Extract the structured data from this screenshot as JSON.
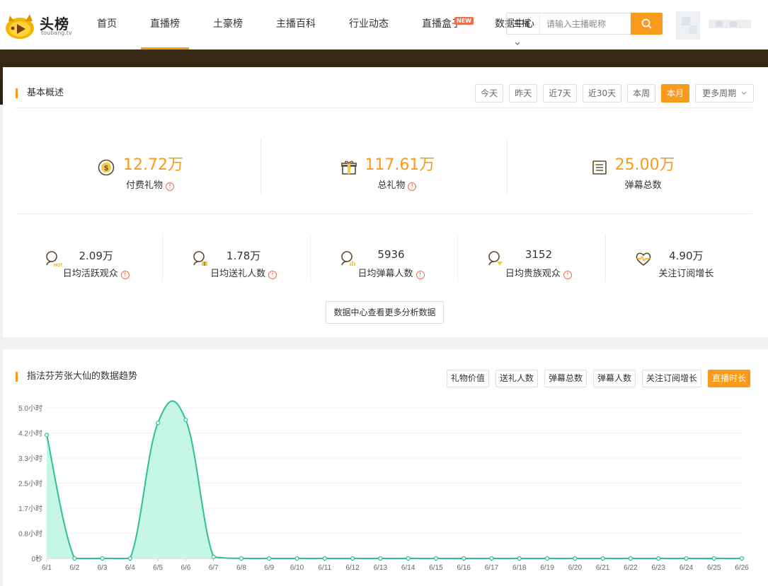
{
  "header": {
    "logo_text": "头榜",
    "logo_sub": "toubang.tv",
    "nav": [
      {
        "label": "首页",
        "active": false,
        "badge": ""
      },
      {
        "label": "直播榜",
        "active": true,
        "badge": ""
      },
      {
        "label": "土豪榜",
        "active": false,
        "badge": ""
      },
      {
        "label": "主播百科",
        "active": false,
        "badge": ""
      },
      {
        "label": "行业动态",
        "active": false,
        "badge": ""
      },
      {
        "label": "直播盒子",
        "active": false,
        "badge": "NEW"
      },
      {
        "label": "数据中心",
        "active": false,
        "badge": ""
      }
    ],
    "search": {
      "type_label": "主播",
      "placeholder": "请输入主播昵称"
    }
  },
  "overview": {
    "title": "基本概述",
    "periods": [
      {
        "label": "今天",
        "active": false
      },
      {
        "label": "昨天",
        "active": false
      },
      {
        "label": "近7天",
        "active": false
      },
      {
        "label": "近30天",
        "active": false
      },
      {
        "label": "本周",
        "active": false
      },
      {
        "label": "本月",
        "active": true
      }
    ],
    "more_period": "更多周期",
    "big_stats": [
      {
        "icon": "coin-icon",
        "value": "12.72万",
        "label": "付费礼物",
        "info": true
      },
      {
        "icon": "gift-icon",
        "value": "117.61万",
        "label": "总礼物",
        "info": true
      },
      {
        "icon": "list-icon",
        "value": "25.00万",
        "label": "弹幕总数",
        "info": false
      }
    ],
    "small_stats": [
      {
        "icon": "hot-user-icon",
        "value": "2.09万",
        "label": "日均活跃观众",
        "info": true
      },
      {
        "icon": "gift-user-icon",
        "value": "1.78万",
        "label": "日均送礼人数",
        "info": true
      },
      {
        "icon": "chart-user-icon",
        "value": "5936",
        "label": "日均弹幕人数",
        "info": true
      },
      {
        "icon": "vip-user-icon",
        "value": "3152",
        "label": "日均贵族观众",
        "info": true
      },
      {
        "icon": "heart-pulse-icon",
        "value": "4.90万",
        "label": "关注订阅增长",
        "info": false
      }
    ],
    "more_button": "数据中心查看更多分析数据"
  },
  "trend": {
    "title": "指法芬芳张大仙的数据趋势",
    "metrics": [
      {
        "label": "礼物价值",
        "active": false
      },
      {
        "label": "送礼人数",
        "active": false
      },
      {
        "label": "弹幕总数",
        "active": false
      },
      {
        "label": "弹幕人数",
        "active": false
      },
      {
        "label": "关注订阅增长",
        "active": false
      },
      {
        "label": "直播时长",
        "active": true
      }
    ]
  },
  "colors": {
    "accent": "#f99a1c",
    "info": "#f26d4e",
    "line": "#2ec28a",
    "area": "#c2f7e3"
  },
  "chart_data": {
    "type": "area",
    "x": [
      "6/1",
      "6/2",
      "6/3",
      "6/4",
      "6/5",
      "6/6",
      "6/7",
      "6/8",
      "6/9",
      "6/10",
      "6/11",
      "6/12",
      "6/13",
      "6/14",
      "6/15",
      "6/16",
      "6/17",
      "6/18",
      "6/19",
      "6/20",
      "6/21",
      "6/22",
      "6/23",
      "6/24",
      "6/25",
      "6/26"
    ],
    "series": [
      {
        "values": [
          4.1,
          0,
          0,
          0,
          4.5,
          4.6,
          0.05,
          0,
          0,
          0,
          0,
          0,
          0,
          0,
          0,
          0,
          0,
          0,
          0,
          0,
          0,
          0,
          0,
          0,
          0,
          0
        ]
      }
    ],
    "y_ticks": [
      "0秒",
      "0.8小时",
      "1.7小时",
      "2.5小时",
      "3.3小时",
      "4.2小时",
      "5.0小时"
    ],
    "ylim": [
      0,
      5.0
    ],
    "unit": "小时",
    "grid": true,
    "legend": "none"
  }
}
